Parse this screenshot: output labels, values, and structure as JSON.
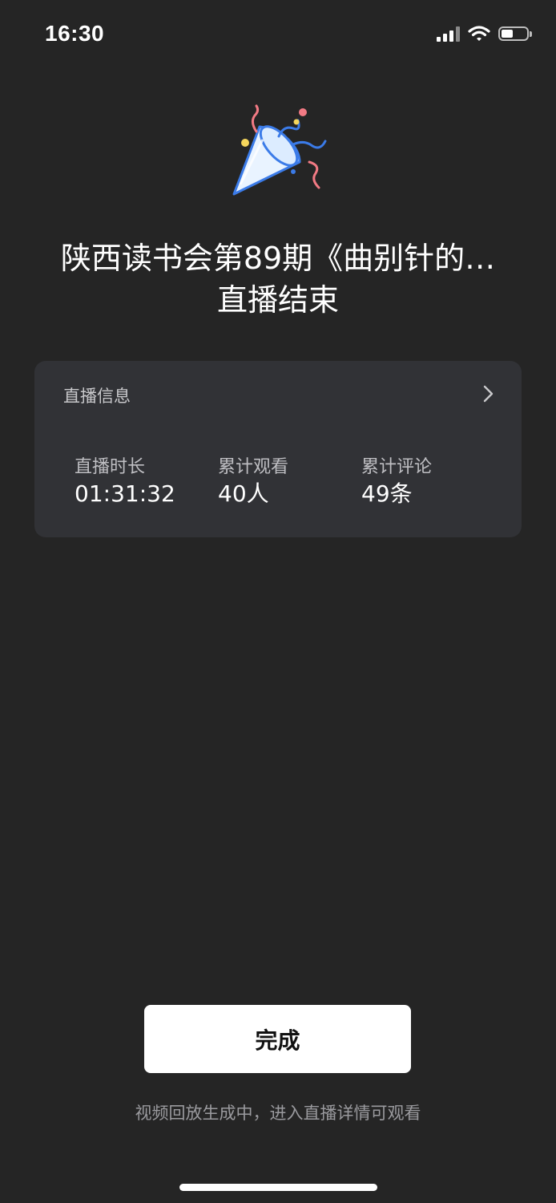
{
  "status_bar": {
    "time": "16:30"
  },
  "title": {
    "line1": "陕西读书会第89期《曲别针的…",
    "line2": "直播结束"
  },
  "info_card": {
    "header": "直播信息",
    "stats": [
      {
        "label": "直播时长",
        "value": "01:31:32"
      },
      {
        "label": "累计观看",
        "value": "40人"
      },
      {
        "label": "累计评论",
        "value": "49条"
      }
    ]
  },
  "done_button": {
    "label": "完成"
  },
  "hint": "视频回放生成中，进入直播详情可观看",
  "colors": {
    "background": "#252525",
    "card": "#313236",
    "confetti_pink": "#f27a84",
    "confetti_yellow": "#f5d65c",
    "confetti_blue": "#3b7be8"
  }
}
